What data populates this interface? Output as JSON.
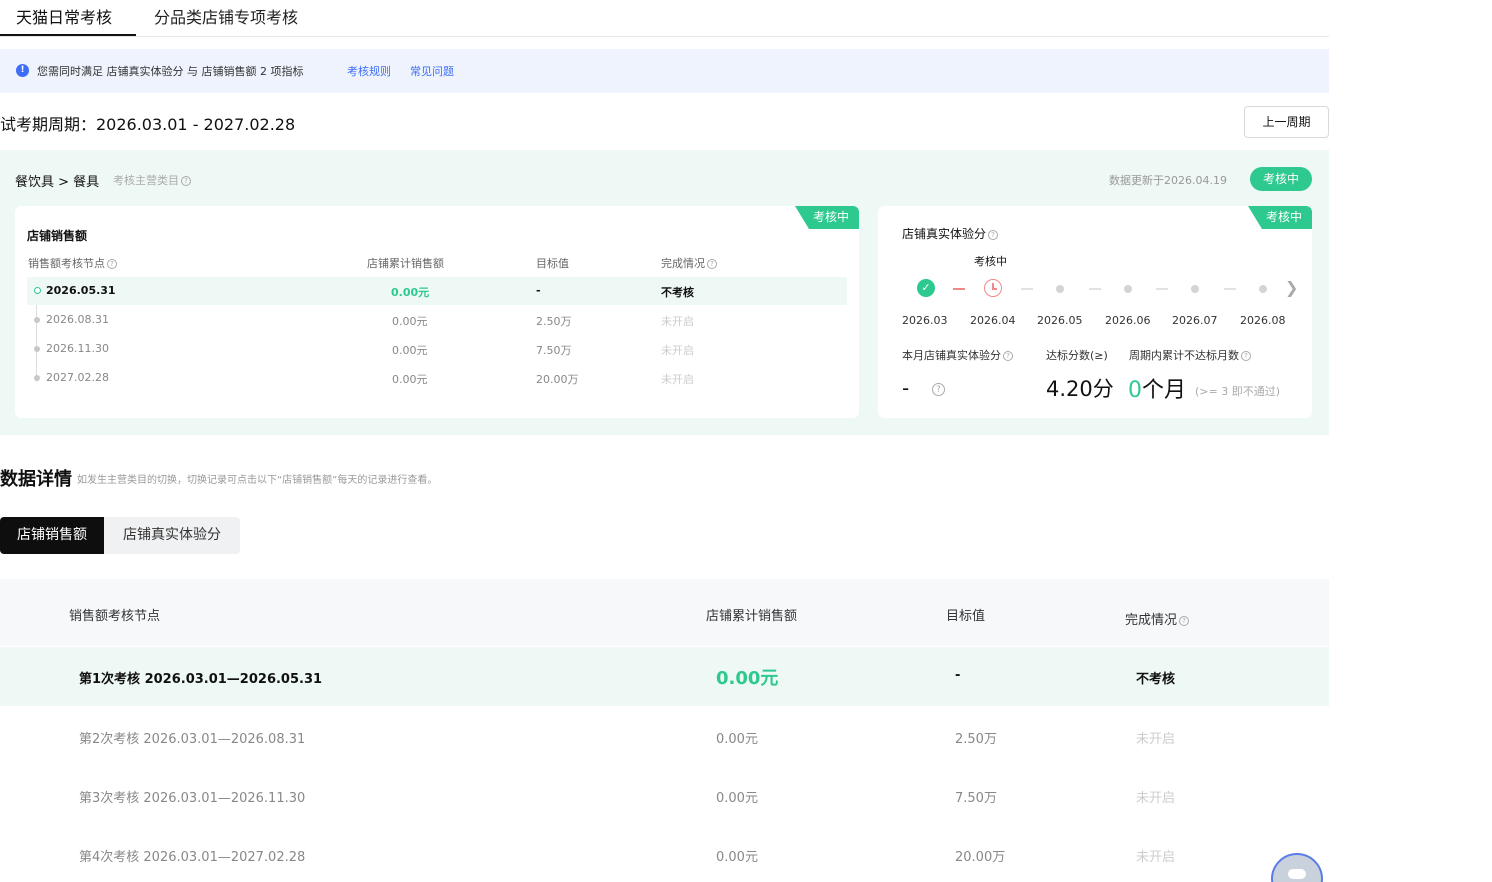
{
  "tabs": [
    {
      "label": "天猫日常考核"
    },
    {
      "label": "分品类店铺专项考核"
    }
  ],
  "notice": {
    "icon": "info-icon",
    "message": "您需同时满足 店铺真实体验分 与 店铺销售额 2 项指标",
    "link_rules": "考核规则",
    "link_faq": "常见问题"
  },
  "period": {
    "label": "试考期周期：2026.03.01 - 2027.02.28",
    "prev_button": "上一周期"
  },
  "panel": {
    "crumb": "餐饮具 > 餐具",
    "crumb_sub": "考核主营类目",
    "updated": "数据更新于2026.04.19",
    "status": "考核中"
  },
  "sales_card": {
    "tag": "考核中",
    "title": "店铺销售额",
    "headers": [
      "销售额考核节点",
      "店铺累计销售额",
      "目标值",
      "完成情况"
    ],
    "rows": [
      {
        "date": "2026.05.31",
        "sales": "0.00元",
        "target": "-",
        "status": "不考核"
      },
      {
        "date": "2026.08.31",
        "sales": "0.00元",
        "target": "2.50万",
        "status": "未开启"
      },
      {
        "date": "2026.11.30",
        "sales": "0.00元",
        "target": "7.50万",
        "status": "未开启"
      },
      {
        "date": "2027.02.28",
        "sales": "0.00元",
        "target": "20.00万",
        "status": "未开启"
      }
    ]
  },
  "experience_card": {
    "tag": "考核中",
    "title": "店铺真实体验分",
    "current_label": "考核中",
    "months": [
      "2026.03",
      "2026.04",
      "2026.05",
      "2026.06",
      "2026.07",
      "2026.08"
    ],
    "metric_labels": [
      "本月店铺真实体验分",
      "达标分数(≥)",
      "周期内累计不达标月数"
    ],
    "current_score": "-",
    "target_score": "4.20分",
    "fail_months_num": "0",
    "fail_months_unit": "个月",
    "fail_note": "(>= 3 即不通过)"
  },
  "details": {
    "title": "数据详情",
    "note": "如发生主营类目的切换，切换记录可点击以下“店铺销售额”每天的记录进行查看。",
    "segments": [
      "店铺销售额",
      "店铺真实体验分"
    ],
    "headers": [
      "销售额考核节点",
      "店铺累计销售额",
      "目标值",
      "完成情况"
    ],
    "rows": [
      {
        "node": "第1次考核 2026.03.01—2026.05.31",
        "sales": "0.00元",
        "target": "-",
        "status": "不考核"
      },
      {
        "node": "第2次考核 2026.03.01—2026.08.31",
        "sales": "0.00元",
        "target": "2.50万",
        "status": "未开启"
      },
      {
        "node": "第3次考核 2026.03.01—2026.11.30",
        "sales": "0.00元",
        "target": "7.50万",
        "status": "未开启"
      },
      {
        "node": "第4次考核 2026.03.01—2027.02.28",
        "sales": "0.00元",
        "target": "20.00万",
        "status": "未开启"
      }
    ]
  },
  "colors": {
    "accent_green": "#2ec98f",
    "link_blue": "#3d6ef5",
    "alert_red": "#f08a8a"
  }
}
